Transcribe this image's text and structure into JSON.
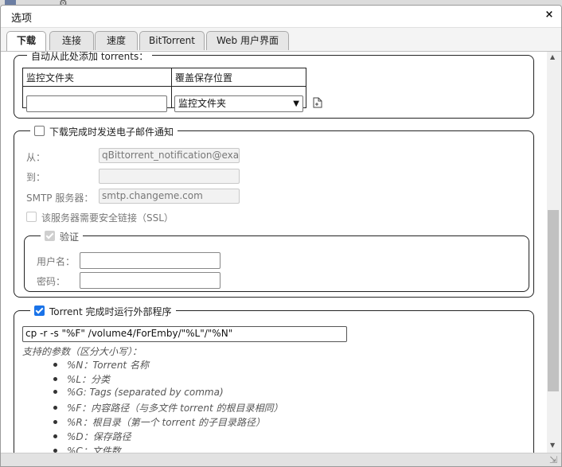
{
  "window": {
    "title": "选项"
  },
  "tabs": [
    {
      "label": "下载",
      "active": true
    },
    {
      "label": "连接",
      "active": false
    },
    {
      "label": "速度",
      "active": false
    },
    {
      "label": "BitTorrent",
      "active": false
    },
    {
      "label": "Web 用户界面",
      "active": false
    }
  ],
  "auto_add": {
    "legend": "自动从此处添加 torrents：",
    "col_watch": "监控文件夹",
    "col_override": "覆盖保存位置",
    "watch_value": "",
    "override_selected": "监控文件夹"
  },
  "email": {
    "legend": "下载完成时发送电子邮件通知",
    "from_label": "从：",
    "from_value": "qBittorrent_notification@exa",
    "to_label": "到：",
    "to_value": "",
    "smtp_label": "SMTP 服务器：",
    "smtp_value": "smtp.changeme.com",
    "ssl_label": "该服务器需要安全链接（SSL）",
    "auth": {
      "legend": "验证",
      "user_label": "用户名：",
      "user_value": "",
      "pass_label": "密码：",
      "pass_value": ""
    }
  },
  "run_program": {
    "legend": "Torrent 完成时运行外部程序",
    "command": "cp -r -s \"%F\" /volume4/ForEmby/\"%L\"/\"%N\"",
    "params_title": "支持的参数（区分大小写）：",
    "params": [
      "%N：Torrent 名称",
      "%L：分类",
      "%G: Tags (separated by comma)",
      "%F：内容路径（与多文件 torrent 的根目录相同）",
      "%R：根目录（第一个 torrent 的子目录路径）",
      "%D：保存路径",
      "%C：文件数"
    ]
  },
  "icons": {
    "close": "close-icon",
    "add_folder": "add-folder-icon"
  }
}
